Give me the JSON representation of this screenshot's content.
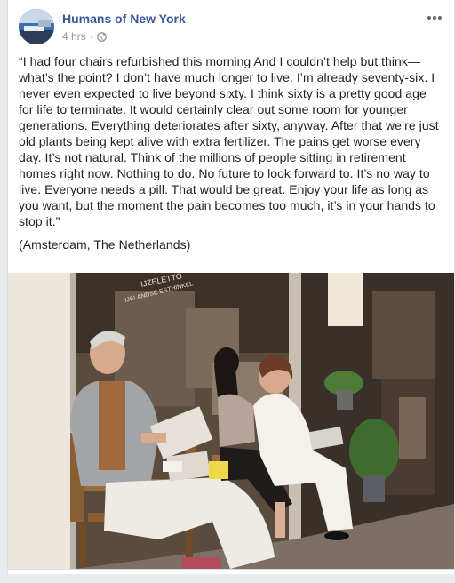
{
  "post": {
    "page_name": "Humans of New York",
    "time": "4 hrs",
    "dot": "·",
    "audience_icon": "globe-icon",
    "more_icon": "more-options-icon",
    "paragraph": "“I had four chairs refurbished this morning And I couldn’t help but think—what’s the point? I don’t have much longer to live. I’m already seventy-six. I never even expected to live beyond sixty. I think sixty is a pretty good age for life to terminate. It would certainly clear out some room for younger generations. Everything deteriorates after sixty, anyway. After that we’re just old plants being kept alive with extra fertilizer. The pains get worse every day. It’s not natural. Think of the millions of people sitting in retirement homes right now. Nothing to do. No future to look forward to. It’s no way to live. Everyone needs a pill. That would be great. Enjoy your life as long as you want, but the moment the pain becomes too much, it’s in your hands to stop it.”",
    "location": "(Amsterdam, The Netherlands)",
    "storefront_sign": "IJZELETTO",
    "storefront_subsign": "IJSLANDSE ESTHINKEL"
  },
  "colors": {
    "page_link": "#385898",
    "meta_text": "#90949c",
    "body_text": "#1d2129",
    "background": "#e9ebee"
  }
}
